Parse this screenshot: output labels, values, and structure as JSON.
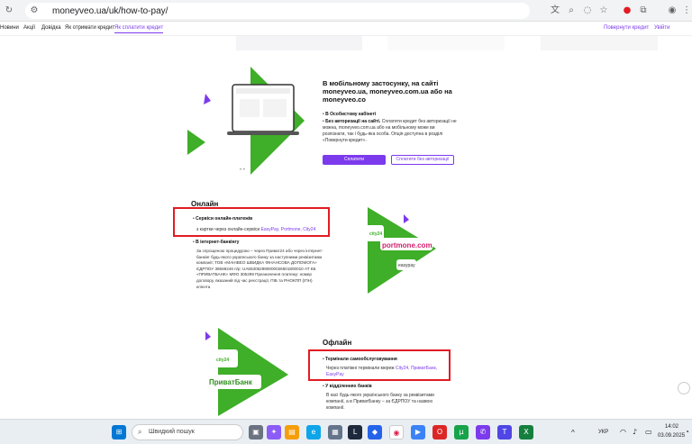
{
  "browser": {
    "url": "moneyveo.ua/uk/how-to-pay/"
  },
  "nav": {
    "items": [
      "Новини",
      "Акції",
      "Довідка",
      "Як отримати кредит",
      "Як сплатити кредит"
    ],
    "right_items": [
      "Повернути кредит",
      "Увійти"
    ]
  },
  "app_section": {
    "title": "В мобільному застосунку, на сайті moneyveo.ua, moneyveo.com.ua або на moneyveo.co",
    "bullet1": "В Особистому кабінеті",
    "bullet2_bold": "Без авторизації на сайті.",
    "bullet2_text": "Сплатити кредит без авторизації не можна, moneyveo.com.ua або на мобільному може ви розпізнати, так і будь-яка особа. Опція доступна в розділі «Повернути кредит».",
    "btn_pay": "Сплатити",
    "btn_pay_noauth": "Сплатити без авторизації"
  },
  "online_section": {
    "title": "Онлайн",
    "item1_title": "Сервіси онлайн-платежів",
    "item1_text_prefix": "з картки через онлайн-сервіси",
    "item1_links": "EasyPay, Portmone, City24",
    "item2_title": "В інтернет-банкінгу",
    "item2_text": "За спрощеною процедурою – через Приват24 або через інтернет-банкінг будь-якого українського банку за наступними реквізитами компанії: ТОВ «МАНІВЕО ШВИДКА ФІНАНСОВА ДОПОМОГА» ЄДРПОУ 38569246 п/р: UA653052990000026501800010 АТ КБ «ПРИВАТБАНК» МФО 305299 Призначення платежу: номер договору, вказаний під час реєстрації, ПІБ та РНОКПП (ІПН) клієнта",
    "logo_city24": "city24",
    "logo_portmone": "portmone.com",
    "logo_easypay": "easypay"
  },
  "offline_section": {
    "title": "Офлайн",
    "item1_title": "Термінали самообслуговування",
    "item1_text_prefix": "Через платіжні термінали мереж",
    "item1_links": "City24, ПриватБанк, EasyPay",
    "item2_title": "У відділеннях банків",
    "item2_text": "В касі будь-якого українського банку за реквізитами компанії, а в ПриватБанку – за ЄДРПОУ та назвою компанії.",
    "logo_city24": "city24",
    "logo_privat": "ПриватБанк"
  },
  "taskbar": {
    "search_placeholder": "Швидкий пошук",
    "lang": "УКР",
    "time": "14:02",
    "date": "03.09.2025"
  },
  "colors": {
    "accent": "#7c3aed",
    "green": "#3fae29",
    "highlight": "#e31b23"
  }
}
